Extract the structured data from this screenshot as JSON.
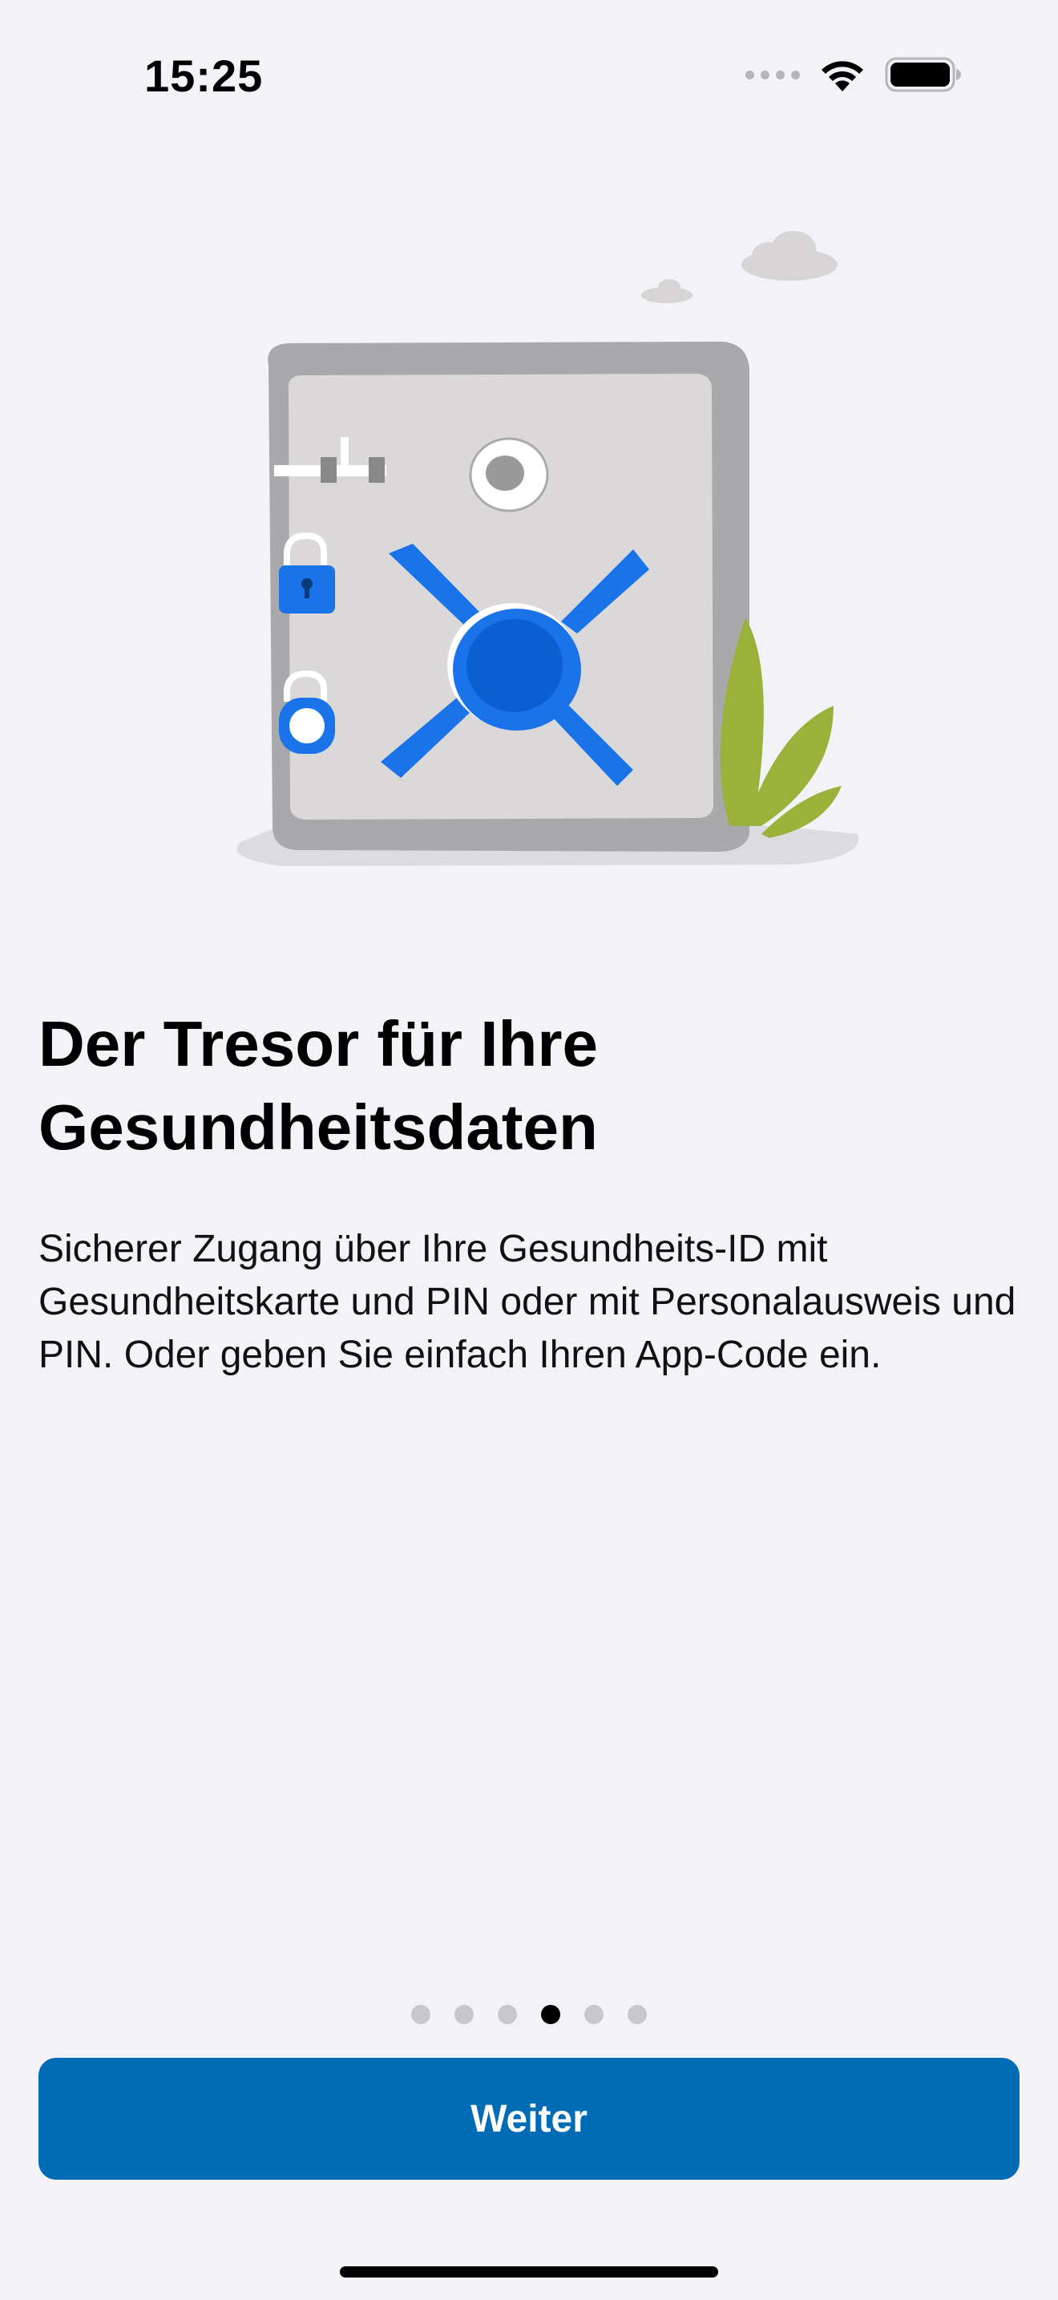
{
  "status_bar": {
    "time": "15:25",
    "icons": [
      "cellular-signal-icon",
      "wifi-icon",
      "battery-icon"
    ]
  },
  "illustration": {
    "name": "vault-illustration"
  },
  "content": {
    "headline": "Der Tresor für Ihre Gesundheitsdaten",
    "body": "Sicherer Zugang über Ihre Gesundheits-ID mit Gesundheitskarte und PIN oder mit Personalausweis und PIN. Oder geben Sie einfach Ihren App-Code ein."
  },
  "pager": {
    "total_pages": 6,
    "current_page": 4
  },
  "actions": {
    "next_label": "Weiter"
  },
  "colors": {
    "background": "#f2f2f7",
    "accent": "#006cb5",
    "vault_blue": "#1a73e8",
    "leaf_green": "#9ab23a"
  }
}
